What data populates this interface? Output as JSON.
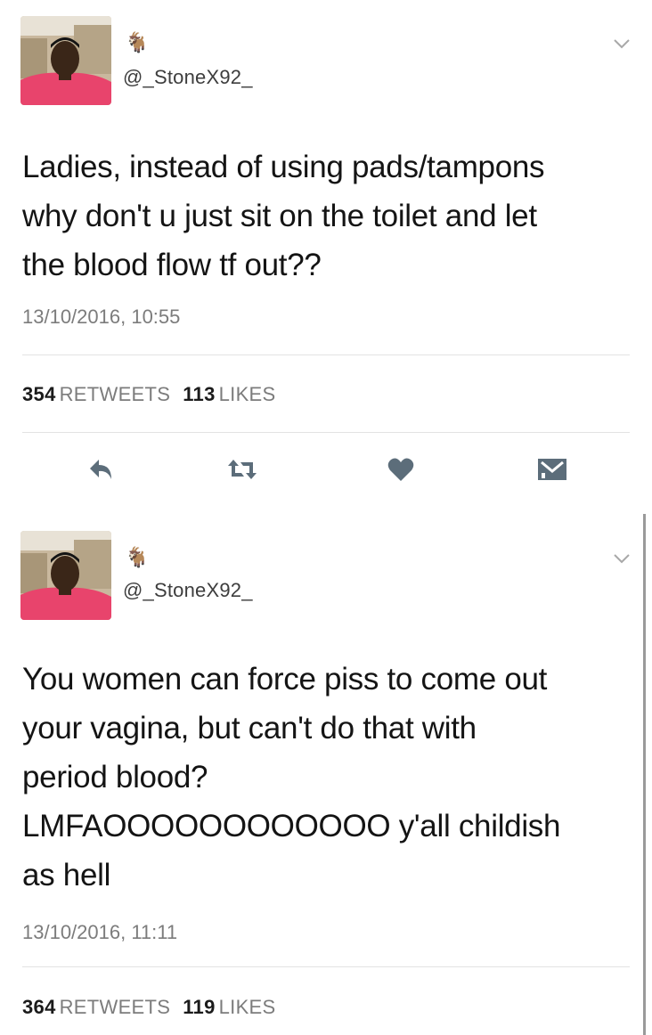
{
  "tweets": [
    {
      "emoji": "🐐",
      "handle": "@_StoneX92_",
      "text": "Ladies, instead of using pads/tampons\nwhy don't u just sit on the toilet and let\nthe blood flow tf out??",
      "timestamp": "13/10/2016, 10:55",
      "retweets": "354",
      "retweets_label": "RETWEETS",
      "likes": "113",
      "likes_label": "LIKES"
    },
    {
      "emoji": "🐐",
      "handle": "@_StoneX92_",
      "text": "You women can force piss to come out\nyour vagina, but can't do that with\nperiod blood?\nLMFAOOOOOOOOOOOO y'all childish\nas hell",
      "timestamp": "13/10/2016, 11:11",
      "retweets": "364",
      "retweets_label": "RETWEETS",
      "likes": "119",
      "likes_label": "LIKES"
    }
  ],
  "icons": {
    "reply": "reply-icon",
    "retweet": "retweet-icon",
    "like": "heart-icon",
    "message": "message-icon",
    "menu": "chevron-down-icon"
  },
  "colors": {
    "icon_gray": "#5c6d7a",
    "text_gray": "#7c7c7c",
    "avatar_shirt": "#e8446c"
  }
}
